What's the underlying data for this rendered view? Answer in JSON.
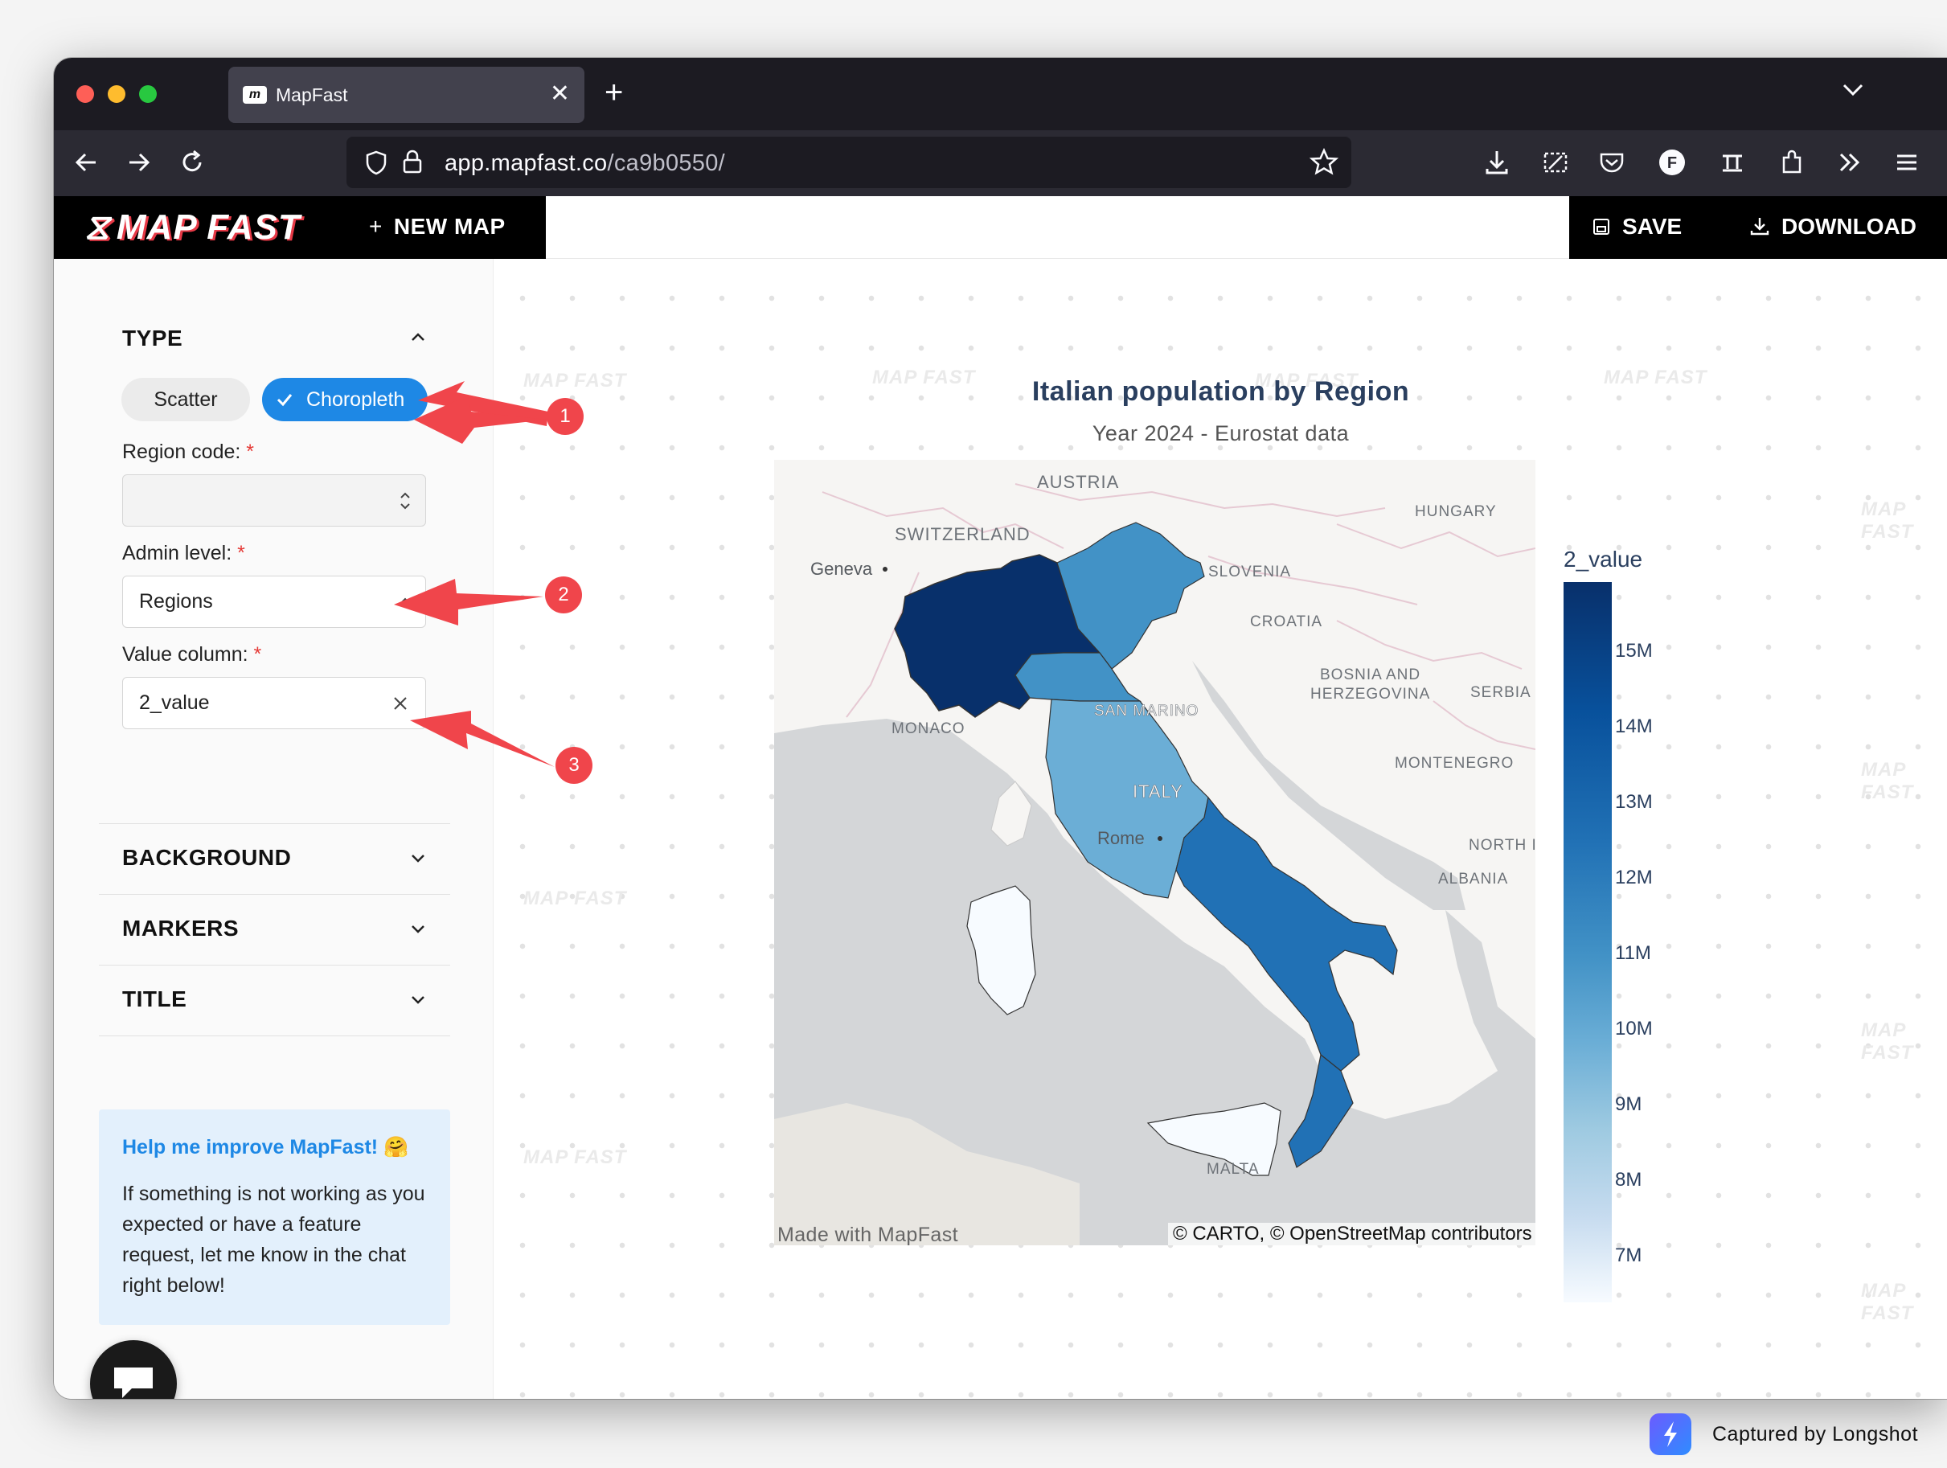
{
  "browser": {
    "tab_title": "MapFast",
    "url_host": "app.mapfast.co",
    "url_path": "/ca9b0550/"
  },
  "header": {
    "logo": "MAP FAST",
    "new_map_label": "NEW MAP",
    "save_label": "SAVE",
    "download_label": "DOWNLOAD"
  },
  "sidebar": {
    "type_section": {
      "title": "TYPE",
      "scatter_label": "Scatter",
      "choropleth_label": "Choropleth",
      "selected": "Choropleth"
    },
    "region_code": {
      "label": "Region code:",
      "required_mark": "*",
      "value": ""
    },
    "admin_level": {
      "label": "Admin level:",
      "required_mark": "*",
      "value": "Regions"
    },
    "value_column": {
      "label": "Value column:",
      "required_mark": "*",
      "value": "2_value"
    },
    "sections": [
      {
        "title": "BACKGROUND"
      },
      {
        "title": "MARKERS"
      },
      {
        "title": "TITLE"
      }
    ],
    "help": {
      "title": "Help me improve MapFast! 🤗",
      "body": "If something is not working as you expected or have a feature request, let me know in the chat right below!"
    }
  },
  "map": {
    "title": "Italian population by Region",
    "subtitle": "Year 2024 - Eurostat data",
    "credit_left": "Made with MapFast",
    "credit_right": "© CARTO, © OpenStreetMap contributors",
    "labels": {
      "austria": "AUSTRIA",
      "hungary": "HUNGARY",
      "switzerland": "SWITZERLAND",
      "geneva": "Geneva",
      "slovenia": "SLOVENIA",
      "croatia": "CROATIA",
      "bosnia1": "BOSNIA AND",
      "bosnia2": "HERZEGOVINA",
      "serbia": "SERBIA",
      "san_marino": "SAN MARINO",
      "monaco": "MONACO",
      "montenegro": "MONTENEGRO",
      "italy": "ITALY",
      "rome": "Rome",
      "north": "NORTH I",
      "albania": "ALBANIA",
      "malta": "MALTA"
    },
    "colorbar": {
      "title": "2_value",
      "ticks": [
        "15M",
        "14M",
        "13M",
        "12M",
        "11M",
        "10M",
        "9M",
        "8M",
        "7M"
      ],
      "colors": [
        "#08306b",
        "#08519c",
        "#2171b5",
        "#4292c6",
        "#6baed6",
        "#9ecae1",
        "#c6dbef",
        "#f7fbff"
      ]
    }
  },
  "annotations": [
    "1",
    "2",
    "3"
  ],
  "watermark": "MAP FAST",
  "capture_credit": "Captured by Longshot"
}
